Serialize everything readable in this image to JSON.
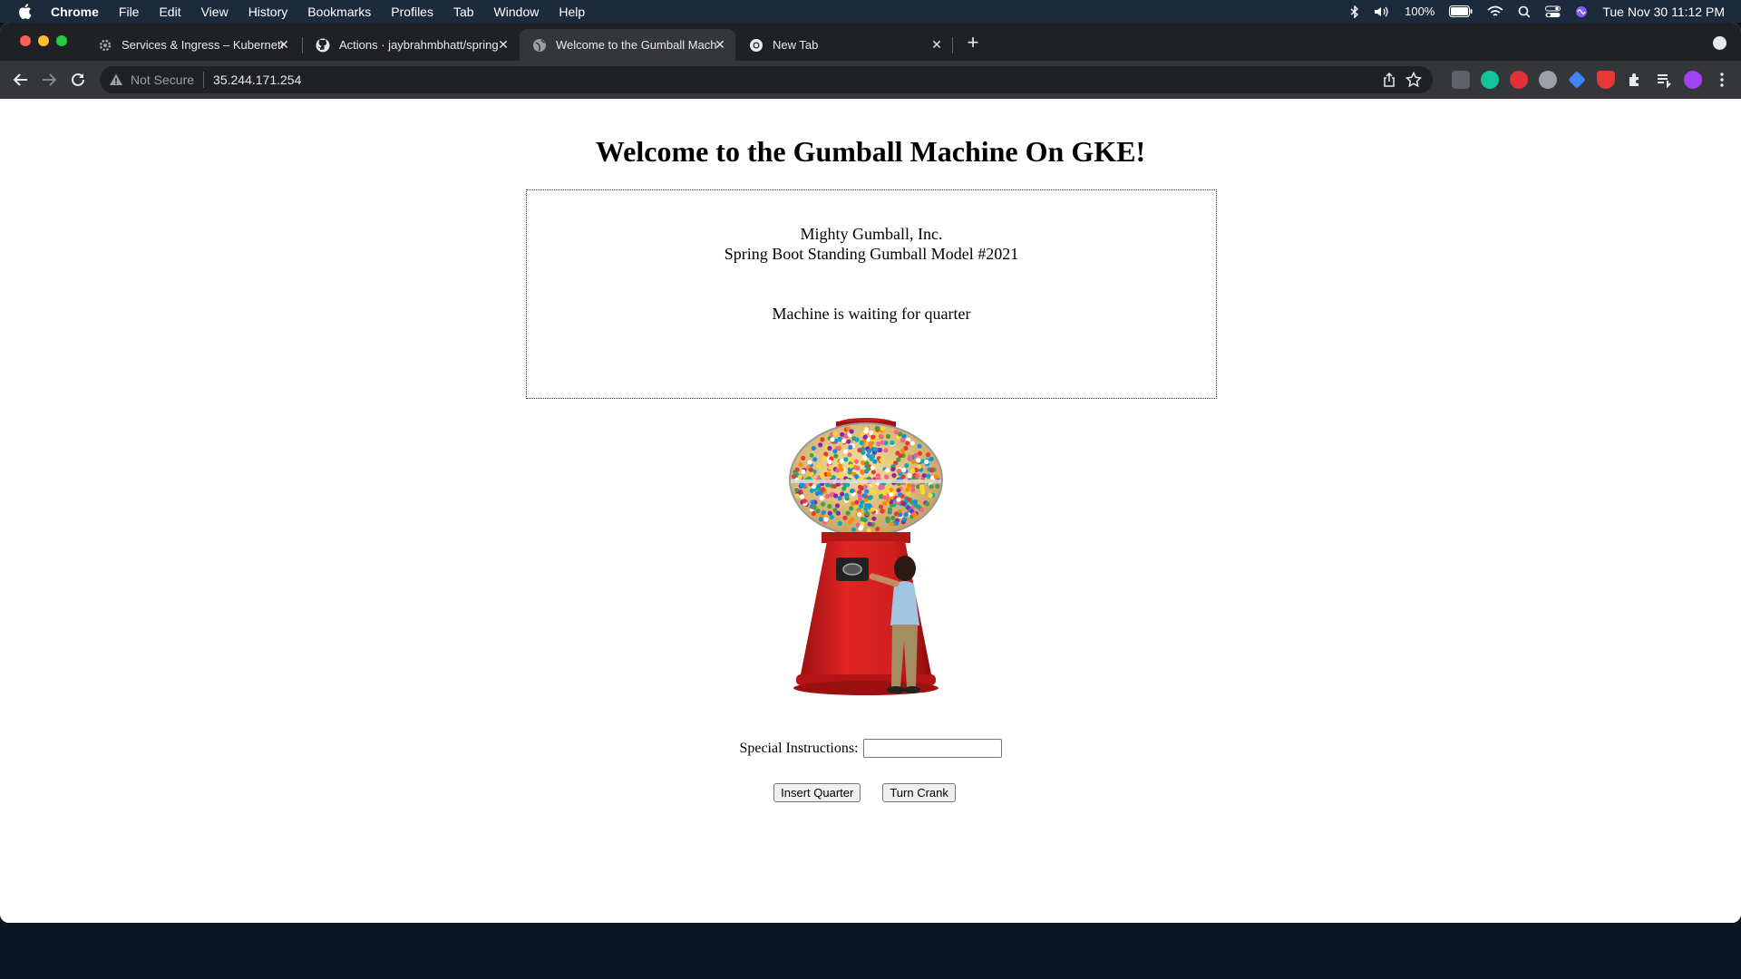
{
  "menubar": {
    "app_name": "Chrome",
    "items": [
      "File",
      "Edit",
      "View",
      "History",
      "Bookmarks",
      "Profiles",
      "Tab",
      "Window",
      "Help"
    ],
    "battery": "100%",
    "datetime": "Tue Nov 30  11:12 PM"
  },
  "tabs": [
    {
      "title": "Services & Ingress – Kubernetes",
      "icon": "gear-icon"
    },
    {
      "title": "Actions · jaybrahmbhatt/spring",
      "icon": "github-icon"
    },
    {
      "title": "Welcome to the Gumball Machine",
      "icon": "globe-icon",
      "active": true
    },
    {
      "title": "New Tab",
      "icon": "chrome-icon"
    }
  ],
  "address_bar": {
    "security_label": "Not Secure",
    "url": "35.244.171.254"
  },
  "page": {
    "title": "Welcome to the Gumball Machine On GKE!",
    "company": "Mighty Gumball, Inc.",
    "model": "Spring Boot Standing Gumball Model #2021",
    "status": "Machine is waiting for quarter",
    "image_alt": "Gumball machine",
    "instructions_label": "Special Instructions:",
    "instructions_value": "",
    "insert_quarter_label": "Insert Quarter",
    "turn_crank_label": "Turn Crank"
  },
  "colors": {
    "menubar_bg": "#1c2a3d",
    "tabstrip_bg": "#202124",
    "toolbar_bg": "#35363a",
    "machine_red": "#d11f1f"
  }
}
